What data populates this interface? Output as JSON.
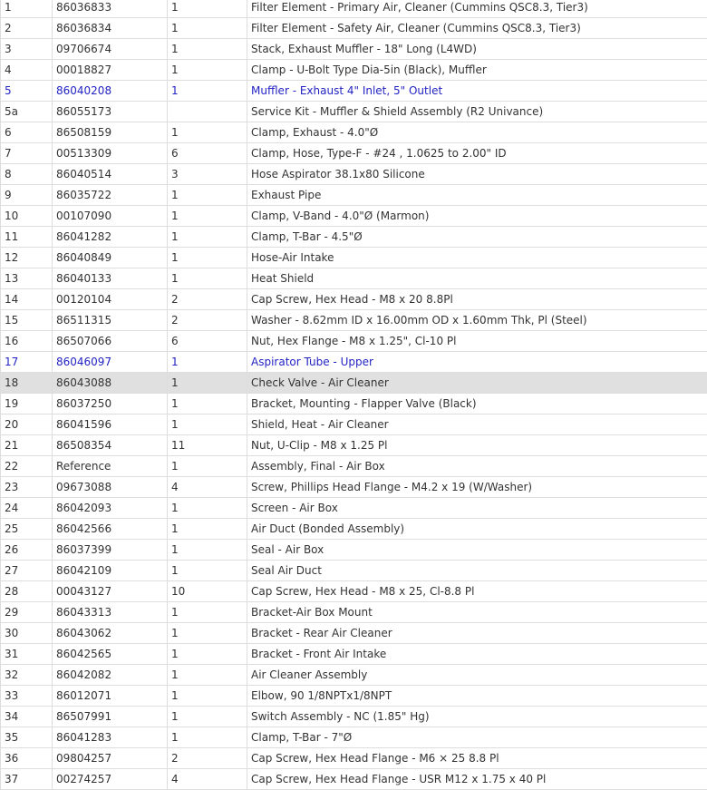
{
  "rows": [
    {
      "item": "1",
      "part": "86036833",
      "qty": "1",
      "desc": "Filter Element - Primary Air, Cleaner (Cummins QSC8.3, Tier3)"
    },
    {
      "item": "2",
      "part": "86036834",
      "qty": "1",
      "desc": "Filter Element - Safety Air, Cleaner (Cummins QSC8.3, Tier3)"
    },
    {
      "item": "3",
      "part": "09706674",
      "qty": "1",
      "desc": "Stack, Exhaust Muffler - 18\" Long (L4WD)"
    },
    {
      "item": "4",
      "part": "00018827",
      "qty": "1",
      "desc": "Clamp - U-Bolt Type Dia-5in (Black), Muffler"
    },
    {
      "item": "5",
      "part": "86040208",
      "qty": "1",
      "desc": "Muffler - Exhaust 4\" Inlet, 5\" Outlet",
      "link": true
    },
    {
      "item": "5a",
      "part": "86055173",
      "qty": "",
      "desc": "Service Kit - Muffler & Shield Assembly (R2 Univance)"
    },
    {
      "item": "6",
      "part": "86508159",
      "qty": "1",
      "desc": "Clamp, Exhaust - 4.0\"Ø"
    },
    {
      "item": "7",
      "part": "00513309",
      "qty": "6",
      "desc": "Clamp, Hose, Type-F - #24 , 1.0625 to 2.00\" ID"
    },
    {
      "item": "8",
      "part": "86040514",
      "qty": "3",
      "desc": "Hose Aspirator 38.1x80 Silicone"
    },
    {
      "item": "9",
      "part": "86035722",
      "qty": "1",
      "desc": "Exhaust Pipe"
    },
    {
      "item": "10",
      "part": "00107090",
      "qty": "1",
      "desc": "Clamp, V-Band - 4.0\"Ø (Marmon)"
    },
    {
      "item": "11",
      "part": "86041282",
      "qty": "1",
      "desc": "Clamp, T-Bar - 4.5\"Ø"
    },
    {
      "item": "12",
      "part": "86040849",
      "qty": "1",
      "desc": "Hose-Air Intake"
    },
    {
      "item": "13",
      "part": "86040133",
      "qty": "1",
      "desc": "Heat Shield"
    },
    {
      "item": "14",
      "part": "00120104",
      "qty": "2",
      "desc": "Cap Screw, Hex Head - M8 x 20 8.8Pl"
    },
    {
      "item": "15",
      "part": "86511315",
      "qty": "2",
      "desc": "Washer - 8.62mm ID x 16.00mm OD x 1.60mm Thk, Pl (Steel)"
    },
    {
      "item": "16",
      "part": "86507066",
      "qty": "6",
      "desc": "Nut, Hex Flange - M8 x 1.25\", Cl-10 Pl"
    },
    {
      "item": "17",
      "part": "86046097",
      "qty": "1",
      "desc": "Aspirator Tube - Upper",
      "link": true
    },
    {
      "item": "18",
      "part": "86043088",
      "qty": "1",
      "desc": "Check Valve - Air Cleaner",
      "selected": true
    },
    {
      "item": "19",
      "part": "86037250",
      "qty": "1",
      "desc": "Bracket, Mounting - Flapper Valve (Black)"
    },
    {
      "item": "20",
      "part": "86041596",
      "qty": "1",
      "desc": "Shield, Heat - Air Cleaner"
    },
    {
      "item": "21",
      "part": "86508354",
      "qty": "11",
      "desc": "Nut, U-Clip - M8 x 1.25 Pl"
    },
    {
      "item": "22",
      "part": "Reference",
      "qty": "1",
      "desc": "Assembly, Final - Air Box"
    },
    {
      "item": "23",
      "part": "09673088",
      "qty": "4",
      "desc": "Screw, Phillips Head Flange - M4.2 x 19 (W/Washer)"
    },
    {
      "item": "24",
      "part": "86042093",
      "qty": "1",
      "desc": "Screen - Air Box"
    },
    {
      "item": "25",
      "part": "86042566",
      "qty": "1",
      "desc": "Air Duct (Bonded Assembly)"
    },
    {
      "item": "26",
      "part": "86037399",
      "qty": "1",
      "desc": "Seal - Air Box"
    },
    {
      "item": "27",
      "part": "86042109",
      "qty": "1",
      "desc": "Seal Air Duct"
    },
    {
      "item": "28",
      "part": "00043127",
      "qty": "10",
      "desc": "Cap Screw, Hex Head - M8 x 25, Cl-8.8 Pl"
    },
    {
      "item": "29",
      "part": "86043313",
      "qty": "1",
      "desc": "Bracket-Air Box Mount"
    },
    {
      "item": "30",
      "part": "86043062",
      "qty": "1",
      "desc": "Bracket - Rear Air Cleaner"
    },
    {
      "item": "31",
      "part": "86042565",
      "qty": "1",
      "desc": "Bracket - Front Air Intake"
    },
    {
      "item": "32",
      "part": "86042082",
      "qty": "1",
      "desc": "Air Cleaner Assembly"
    },
    {
      "item": "33",
      "part": "86012071",
      "qty": "1",
      "desc": "Elbow, 90 1/8NPTx1/8NPT"
    },
    {
      "item": "34",
      "part": "86507991",
      "qty": "1",
      "desc": "Switch Assembly - NC (1.85\" Hg)"
    },
    {
      "item": "35",
      "part": "86041283",
      "qty": "1",
      "desc": "Clamp, T-Bar - 7\"Ø"
    },
    {
      "item": "36",
      "part": "09804257",
      "qty": "2",
      "desc": "Cap Screw, Hex Head Flange - M6 × 25 8.8 Pl"
    },
    {
      "item": "37",
      "part": "00274257",
      "qty": "4",
      "desc": "Cap Screw, Hex Head Flange - USR M12 x 1.75 x 40 Pl"
    }
  ],
  "colors": {
    "link": "#2323c4",
    "selected_row": "#e0e0e0",
    "text": "#333333",
    "border": "#dddddd"
  }
}
